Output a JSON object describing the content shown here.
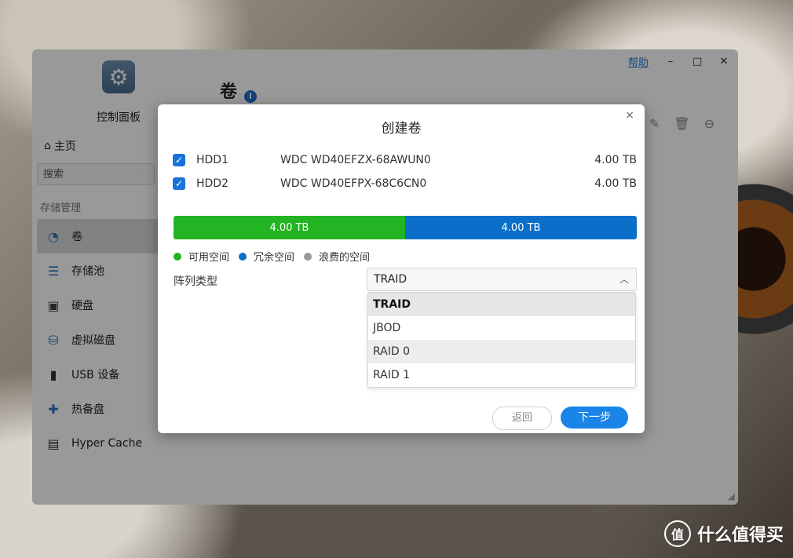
{
  "window": {
    "help_label": "帮助",
    "minimize": "–",
    "maximize": "□",
    "close": "✕"
  },
  "sidebar": {
    "app_title": "控制面板",
    "home_label": "主页",
    "search_placeholder": "搜索",
    "section_label": "存储管理",
    "items": [
      {
        "label": "卷",
        "icon": "pie-chart-icon"
      },
      {
        "label": "存储池",
        "icon": "database-icon"
      },
      {
        "label": "硬盘",
        "icon": "hard-disk-icon"
      },
      {
        "label": "虚拟磁盘",
        "icon": "virtual-disk-icon"
      },
      {
        "label": "USB 设备",
        "icon": "usb-icon"
      },
      {
        "label": "热备盘",
        "icon": "hot-spare-icon"
      },
      {
        "label": "Hyper Cache",
        "icon": "cache-icon"
      }
    ]
  },
  "main": {
    "page_title": "卷",
    "info_symbol": "i"
  },
  "modal": {
    "title": "创建卷",
    "close": "×",
    "disks": [
      {
        "name": "HDD1",
        "model": "WDC WD40EFZX-68AWUN0",
        "size": "4.00 TB",
        "checked": true
      },
      {
        "name": "HDD2",
        "model": "WDC WD40EFPX-68C6CN0",
        "size": "4.00 TB",
        "checked": true
      }
    ],
    "capacity_bar": [
      {
        "label": "4.00 TB",
        "color": "#22b422",
        "fraction": 0.5
      },
      {
        "label": "4.00 TB",
        "color": "#0b6fca",
        "fraction": 0.5
      }
    ],
    "legend": [
      {
        "label": "可用空间",
        "color": "#22b422"
      },
      {
        "label": "冗余空间",
        "color": "#0b6fca"
      },
      {
        "label": "浪费的空间",
        "color": "#9a9a9a"
      }
    ],
    "array_type_label": "阵列类型",
    "array_type_value": "TRAID",
    "options": [
      "TRAID",
      "JBOD",
      "RAID 0",
      "RAID 1"
    ],
    "back_button": "返回",
    "next_button": "下一步"
  },
  "watermark": {
    "text": "什么值得买",
    "logo_char": "值"
  }
}
